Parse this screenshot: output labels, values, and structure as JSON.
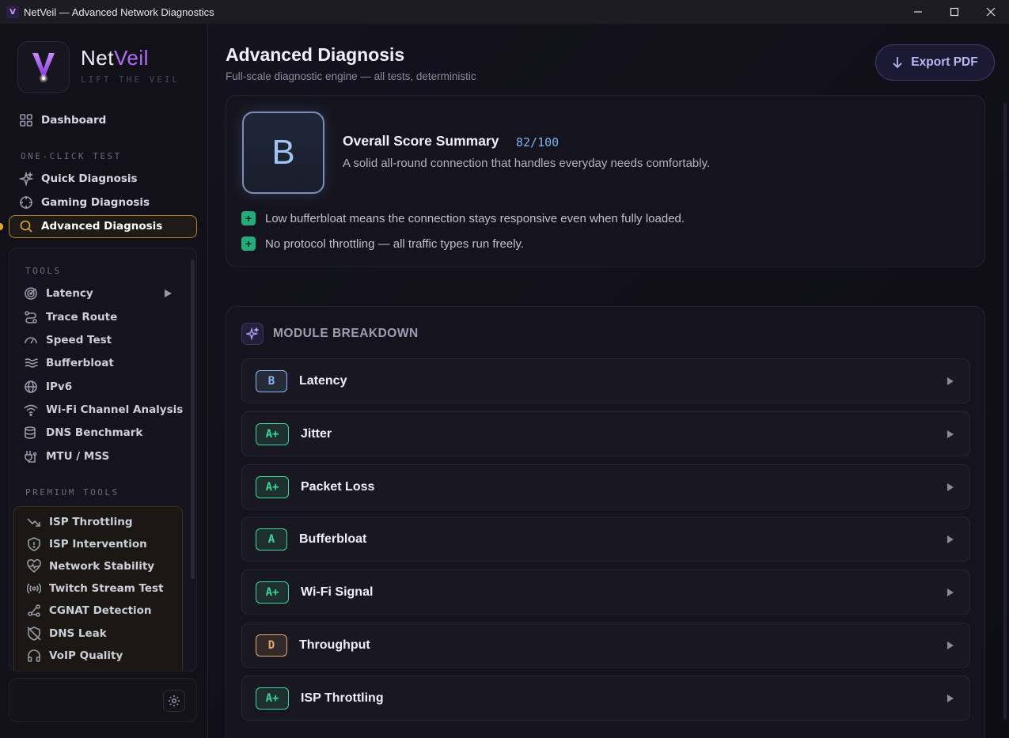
{
  "window": {
    "title": "NetVeil — Advanced Network Diagnostics",
    "app_icon_letter": "V"
  },
  "brand": {
    "name_part1": "Net",
    "name_part2": "Veil",
    "tagline": "LIFT THE VEIL",
    "accent_color": "#b06ef5"
  },
  "nav": {
    "dashboard": "Dashboard",
    "one_click_label": "ONE-CLICK TEST",
    "quick": "Quick Diagnosis",
    "gaming": "Gaming Diagnosis",
    "advanced": "Advanced Diagnosis"
  },
  "tools": {
    "label": "TOOLS",
    "items": [
      "Latency",
      "Trace Route",
      "Speed Test",
      "Bufferbloat",
      "IPv6",
      "Wi-Fi Channel Analysis",
      "DNS Benchmark",
      "MTU / MSS"
    ]
  },
  "premium": {
    "label": "PREMIUM TOOLS",
    "items": [
      "ISP Throttling",
      "ISP Intervention",
      "Network Stability",
      "Twitch Stream Test",
      "CGNAT Detection",
      "DNS Leak",
      "VoIP Quality"
    ]
  },
  "header": {
    "title": "Advanced Diagnosis",
    "subtitle": "Full-scale diagnostic engine — all tests, deterministic",
    "export_label": "Export PDF"
  },
  "summary": {
    "grade": "B",
    "title": "Overall Score Summary",
    "score": "82/100",
    "description": "A solid all-round connection that handles everyday needs comfortably.",
    "positives": [
      "Low bufferbloat means the connection stays responsive even when fully loaded.",
      "No protocol throttling — all traffic types run freely."
    ]
  },
  "modules": {
    "header": "MODULE BREAKDOWN",
    "rows": [
      {
        "grade": "B",
        "name": "Latency"
      },
      {
        "grade": "A+",
        "name": "Jitter"
      },
      {
        "grade": "A+",
        "name": "Packet Loss"
      },
      {
        "grade": "A",
        "name": "Bufferbloat"
      },
      {
        "grade": "A+",
        "name": "Wi-Fi Signal"
      },
      {
        "grade": "D",
        "name": "Throughput"
      },
      {
        "grade": "A+",
        "name": "ISP Throttling"
      }
    ]
  },
  "grade_colors": {
    "A+": "#3ed598",
    "A": "#3ed598",
    "B": "#8cb6f0",
    "D": "#e8a66a"
  }
}
